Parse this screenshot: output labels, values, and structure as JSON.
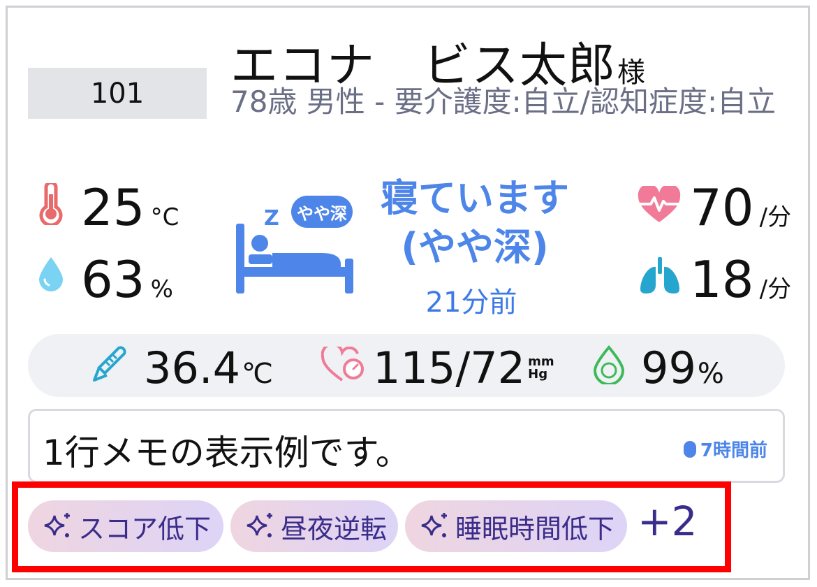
{
  "resident": {
    "room": "101",
    "name": "エコナ　ビス太郎",
    "honorific": "様",
    "details": "78歳 男性 - 要介護度:自立/認知症度:自立"
  },
  "room_env": {
    "temperature": {
      "value": "25",
      "unit": "°C",
      "icon": "thermometer-icon"
    },
    "humidity": {
      "value": "63",
      "unit": "%",
      "icon": "water-drop-icon"
    }
  },
  "sleep": {
    "badge": "やや深",
    "zz": "Z",
    "status": "寝ています",
    "depth": "(やや深)",
    "time_ago": "21分前",
    "icon": "bed-icon"
  },
  "vitals_live": {
    "heart_rate": {
      "value": "70",
      "unit": "/分",
      "icon": "heartbeat-icon"
    },
    "respiration": {
      "value": "18",
      "unit": "/分",
      "icon": "lungs-icon"
    }
  },
  "vitals_measured": {
    "body_temp": {
      "value": "36.4",
      "unit": "℃",
      "icon": "body-thermometer-icon"
    },
    "blood_pressure": {
      "value": "115/72",
      "unit_top": "mm",
      "unit_bottom": "Hg",
      "icon": "blood-pressure-icon"
    },
    "spo2": {
      "value": "99",
      "unit": "%",
      "icon": "oxygen-drop-icon"
    }
  },
  "memo": {
    "text": "1行メモの表示例です。",
    "time_ago": "7時間前"
  },
  "alerts": {
    "tags": [
      {
        "label": "スコア低下",
        "icon": "sparkle-icon"
      },
      {
        "label": "昼夜逆転",
        "icon": "sparkle-icon"
      },
      {
        "label": "睡眠時間低下",
        "icon": "sparkle-icon"
      }
    ],
    "more": "+2"
  },
  "colors": {
    "accent_blue": "#4d86e8",
    "alert_red": "#ff0000",
    "tag_text": "#3a2d8a"
  }
}
